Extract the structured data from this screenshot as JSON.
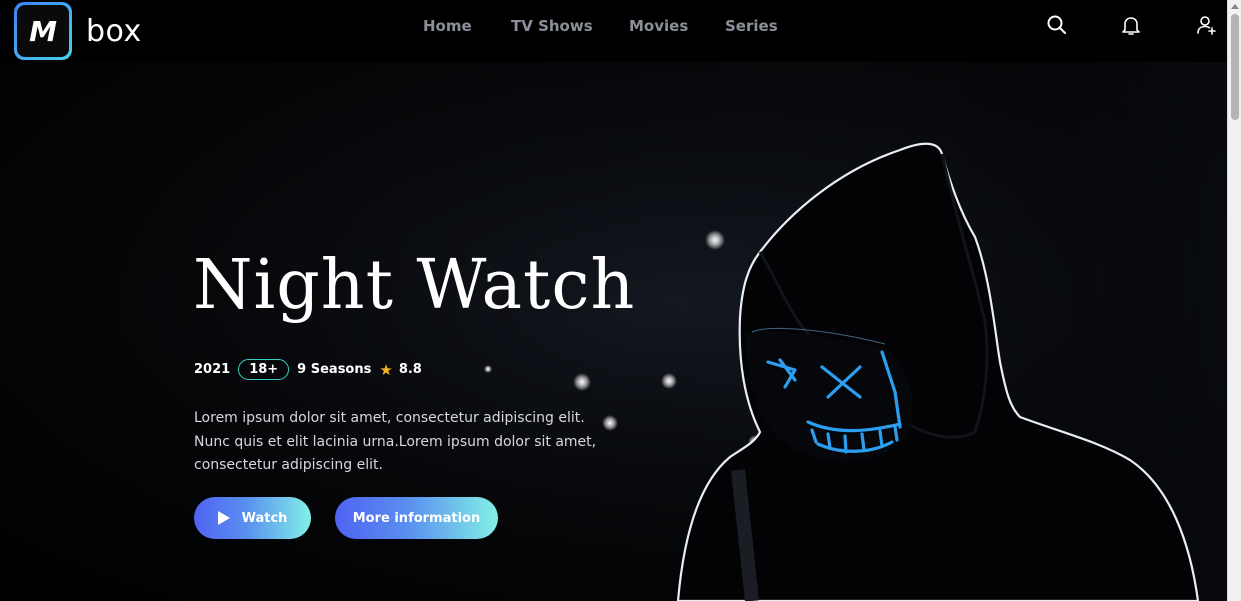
{
  "brand": {
    "logo_letter": "M",
    "name": "box"
  },
  "nav": {
    "items": [
      "Home",
      "TV Shows",
      "Movies",
      "Series"
    ]
  },
  "header_icons": [
    "search-icon",
    "bell-icon",
    "user-add-icon"
  ],
  "hero": {
    "title": "Night Watch",
    "year": "2021",
    "age_rating": "18+",
    "seasons": "9 Seasons",
    "score": "8.8",
    "description": "Lorem ipsum dolor sit amet, consectetur adipiscing elit. Nunc quis et elit lacinia urna.Lorem ipsum dolor sit amet, consectetur adipiscing elit.",
    "watch_label": "Watch",
    "more_label": "More information"
  },
  "colors": {
    "accent_start": "#4f63f3",
    "accent_end": "#82f0e6",
    "badge_border": "#35d0c7",
    "star": "#f5b622",
    "nav_text": "#8b8f99"
  }
}
